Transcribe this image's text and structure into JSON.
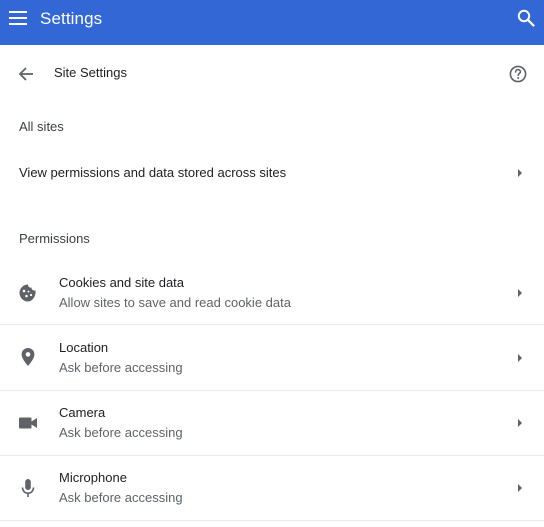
{
  "app": {
    "title": "Settings",
    "menu_icon": "hamburger-menu-icon",
    "search_icon": "search-icon",
    "accent_color": "#3367d6"
  },
  "subheader": {
    "back_icon": "arrow-back-icon",
    "title": "Site Settings",
    "help_icon": "help-circle-icon"
  },
  "all_sites": {
    "heading": "All sites",
    "row_label": "View permissions and data stored across sites",
    "chevron_icon": "chevron-right-icon"
  },
  "permissions": {
    "heading": "Permissions",
    "items": [
      {
        "title": "Cookies and site data",
        "subtitle": "Allow sites to save and read cookie data",
        "icon": "cookie-icon"
      },
      {
        "title": "Location",
        "subtitle": "Ask before accessing",
        "icon": "location-pin-icon"
      },
      {
        "title": "Camera",
        "subtitle": "Ask before accessing",
        "icon": "camera-icon"
      },
      {
        "title": "Microphone",
        "subtitle": "Ask before accessing",
        "icon": "microphone-icon"
      }
    ]
  }
}
